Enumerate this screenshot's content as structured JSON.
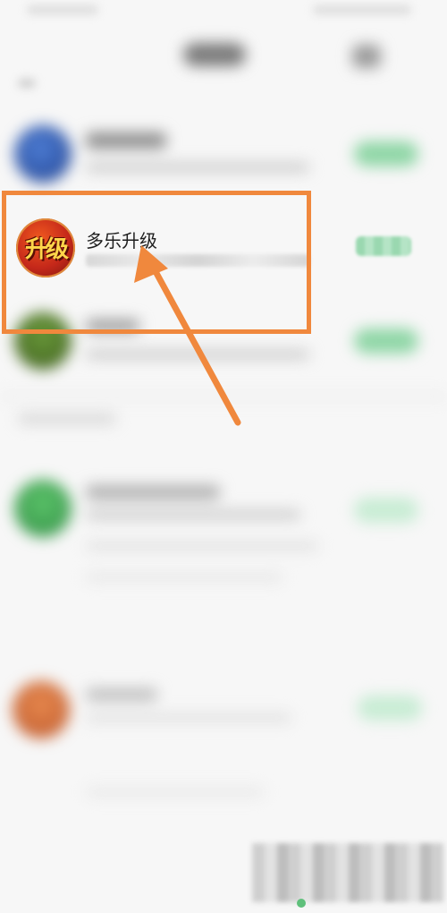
{
  "highlighted_app": {
    "title": "多乐升级",
    "icon_glyph": "升级",
    "icon_name": "game-app-icon"
  },
  "colors": {
    "highlight": "#f0883d",
    "button_green": "#8fd6a6"
  }
}
